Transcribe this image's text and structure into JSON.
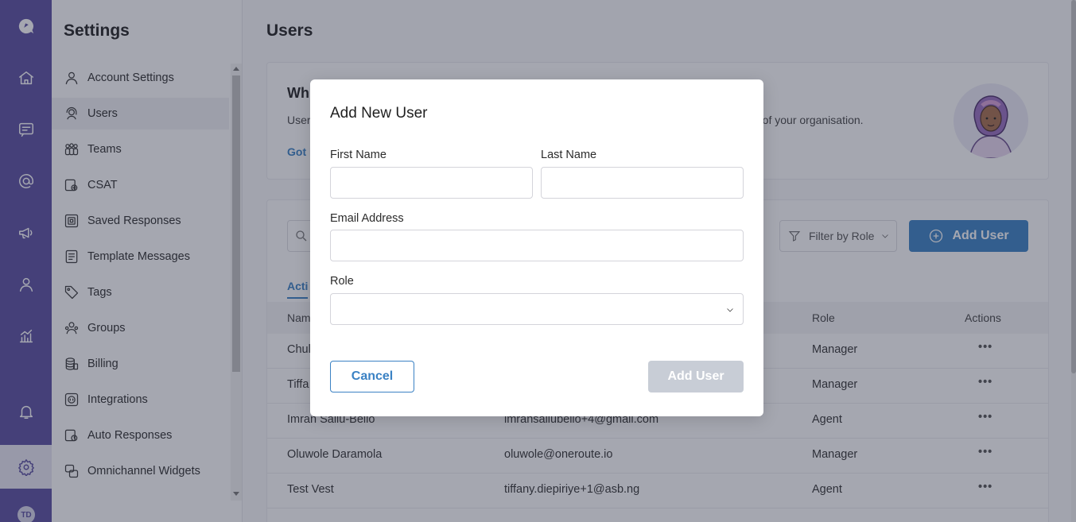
{
  "settings": {
    "title": "Settings"
  },
  "sidebar": {
    "items": [
      {
        "label": "Account Settings",
        "icon": "user-icon"
      },
      {
        "label": "Users",
        "icon": "users-headset-icon"
      },
      {
        "label": "Teams",
        "icon": "team-icon"
      },
      {
        "label": "CSAT",
        "icon": "csat-icon"
      },
      {
        "label": "Saved Responses",
        "icon": "saved-responses-icon"
      },
      {
        "label": "Template Messages",
        "icon": "template-icon"
      },
      {
        "label": "Tags",
        "icon": "tag-icon"
      },
      {
        "label": "Groups",
        "icon": "groups-icon"
      },
      {
        "label": "Billing",
        "icon": "billing-icon"
      },
      {
        "label": "Integrations",
        "icon": "integrations-icon"
      },
      {
        "label": "Auto Responses",
        "icon": "auto-responses-icon"
      },
      {
        "label": "Omnichannel Widgets",
        "icon": "widgets-icon"
      }
    ]
  },
  "rail": {
    "user_initials": "TD"
  },
  "main": {
    "title": "Users",
    "intro": {
      "title": "Wh",
      "desc_left": "User",
      "desc_right": "alf of your organisation.",
      "link": "Got i"
    },
    "toolbar": {
      "filter_label": "Filter by Role",
      "add_user_label": "Add User"
    },
    "tab_active": "Acti",
    "table": {
      "headers": {
        "name": "Nam",
        "role": "Role",
        "actions": "Actions"
      },
      "rows": [
        {
          "name": "Chul",
          "email": "",
          "role": "Manager"
        },
        {
          "name": "Tiffa",
          "email": "",
          "role": "Manager"
        },
        {
          "name": "Imran Saliu-Bello",
          "email": "imransaliubello+4@gmail.com",
          "role": "Agent"
        },
        {
          "name": "Oluwole Daramola",
          "email": "oluwole@oneroute.io",
          "role": "Manager"
        },
        {
          "name": "Test Vest",
          "email": "tiffany.diepiriye+1@asb.ng",
          "role": "Agent"
        }
      ],
      "actions_glyph": "•••"
    }
  },
  "modal": {
    "title": "Add New User",
    "first_name_label": "First Name",
    "first_name_value": "",
    "last_name_label": "Last Name",
    "last_name_value": "",
    "email_label": "Email Address",
    "email_value": "",
    "role_label": "Role",
    "role_value": "",
    "cancel_label": "Cancel",
    "submit_label": "Add User"
  },
  "colors": {
    "rail": "#5a4ea1",
    "primary": "#3b82c4",
    "disabled_button": "#c8cdd6"
  }
}
